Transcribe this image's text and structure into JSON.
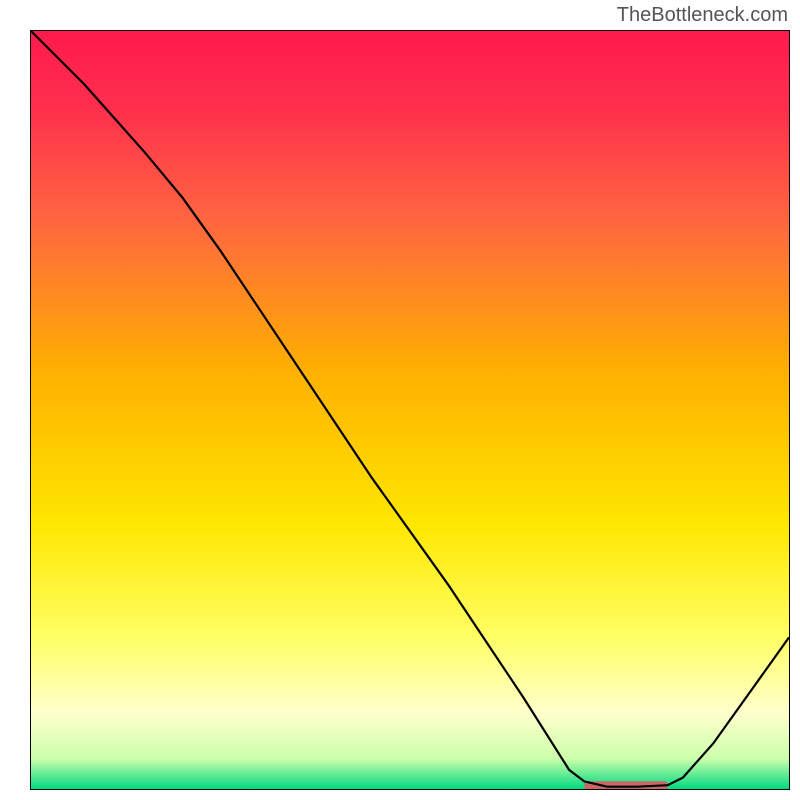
{
  "watermark": "TheBottleneck.com",
  "chart_data": {
    "type": "line",
    "title": "",
    "xlabel": "",
    "ylabel": "",
    "xlim": [
      0,
      100
    ],
    "ylim": [
      0,
      100
    ],
    "gradient_colors": {
      "top": "#ff1a4d",
      "mid_top": "#ff6633",
      "mid": "#ffd700",
      "mid_bottom": "#ffffaa",
      "bottom": "#00e68a"
    },
    "curve": [
      {
        "x": 0,
        "y": 100
      },
      {
        "x": 7,
        "y": 93
      },
      {
        "x": 15,
        "y": 84
      },
      {
        "x": 20,
        "y": 78
      },
      {
        "x": 25,
        "y": 71
      },
      {
        "x": 35,
        "y": 56
      },
      {
        "x": 45,
        "y": 41
      },
      {
        "x": 55,
        "y": 27
      },
      {
        "x": 65,
        "y": 12
      },
      {
        "x": 71,
        "y": 2.5
      },
      {
        "x": 73,
        "y": 1
      },
      {
        "x": 76,
        "y": 0.3
      },
      {
        "x": 80,
        "y": 0.3
      },
      {
        "x": 84,
        "y": 0.5
      },
      {
        "x": 86,
        "y": 1.5
      },
      {
        "x": 90,
        "y": 6
      },
      {
        "x": 95,
        "y": 13
      },
      {
        "x": 100,
        "y": 20
      }
    ],
    "highlight_bar": {
      "x_start": 73,
      "x_end": 84,
      "y": 0.5,
      "color": "#cc6666"
    }
  }
}
